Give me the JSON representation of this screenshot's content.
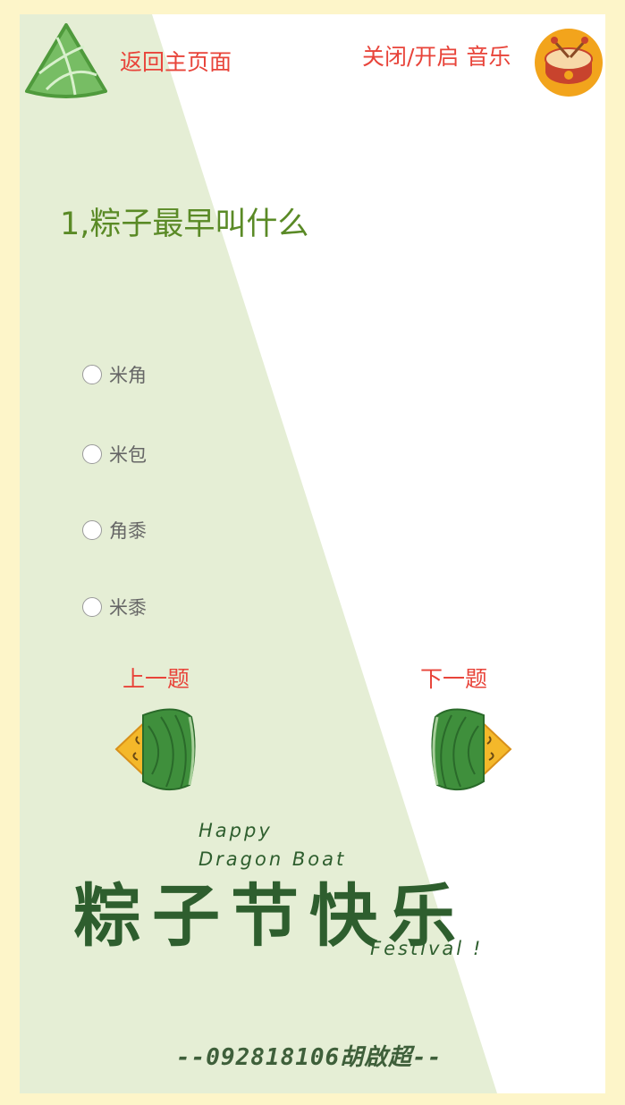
{
  "header": {
    "home_label": "返回主页面",
    "music_label": "关闭/开启 音乐"
  },
  "question": {
    "text": "1,粽子最早叫什么",
    "options": [
      {
        "label": "米角"
      },
      {
        "label": "米包"
      },
      {
        "label": "角黍"
      },
      {
        "label": "米黍"
      }
    ]
  },
  "navigation": {
    "prev_label": "上一题",
    "next_label": "下一题"
  },
  "banner": {
    "chinese_title": "粽子节快乐",
    "english_line1": "Happy",
    "english_line2": "Dragon Boat",
    "english_line3": "Festival !"
  },
  "footer": {
    "credit": "--092818106胡啟超--"
  },
  "colors": {
    "page_bg": "#fdf5c9",
    "diagonal_bg": "#e5eed5",
    "accent_red": "#e8443a",
    "question_green": "#5a8a26",
    "dark_green": "#2e5e2e"
  }
}
